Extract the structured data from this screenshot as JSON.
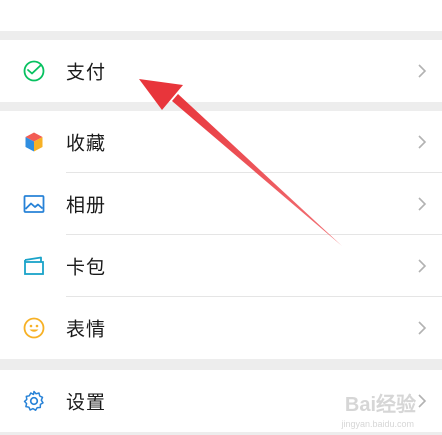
{
  "menu": {
    "pay": {
      "label": "支付",
      "icon": "wallet-check-icon",
      "color": "#07c160"
    },
    "items": [
      {
        "label": "收藏",
        "icon": "cube-icon"
      },
      {
        "label": "相册",
        "icon": "image-icon",
        "color": "#2782d7"
      },
      {
        "label": "卡包",
        "icon": "card-icon",
        "color": "#1aa3c9"
      },
      {
        "label": "表情",
        "icon": "smiley-icon",
        "color": "#f7b125"
      }
    ],
    "settings": {
      "label": "设置",
      "icon": "gear-icon",
      "color": "#2782d7"
    }
  },
  "annotation": {
    "arrow_color": "#e8353b"
  },
  "watermark": {
    "text": "Bai经验",
    "sub": "jingyan.baidu.com"
  }
}
